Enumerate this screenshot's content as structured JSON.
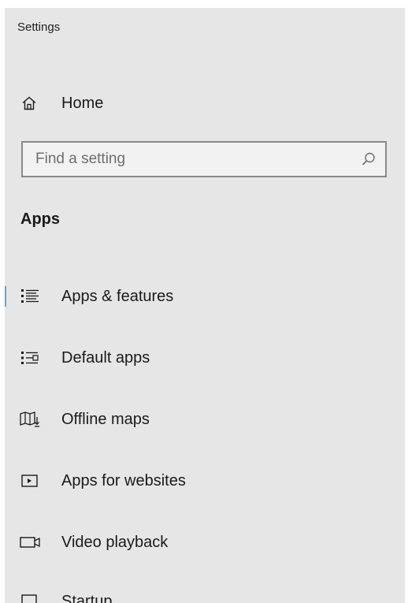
{
  "window": {
    "title": "Settings"
  },
  "home": {
    "label": "Home",
    "icon": "home-icon"
  },
  "search": {
    "placeholder": "Find a setting",
    "value": ""
  },
  "section": {
    "title": "Apps"
  },
  "nav": {
    "items": [
      {
        "label": "Apps & features",
        "icon": "apps-features-icon",
        "selected": true
      },
      {
        "label": "Default apps",
        "icon": "default-apps-icon",
        "selected": false
      },
      {
        "label": "Offline maps",
        "icon": "map-icon",
        "selected": false
      },
      {
        "label": "Apps for websites",
        "icon": "apps-for-websites-icon",
        "selected": false
      },
      {
        "label": "Video playback",
        "icon": "video-icon",
        "selected": false
      },
      {
        "label": "Startup",
        "icon": "startup-icon",
        "selected": false
      }
    ]
  },
  "colors": {
    "background": "#e6e6e6",
    "accent": "#6aa0d6",
    "text": "#1a1a1a"
  }
}
